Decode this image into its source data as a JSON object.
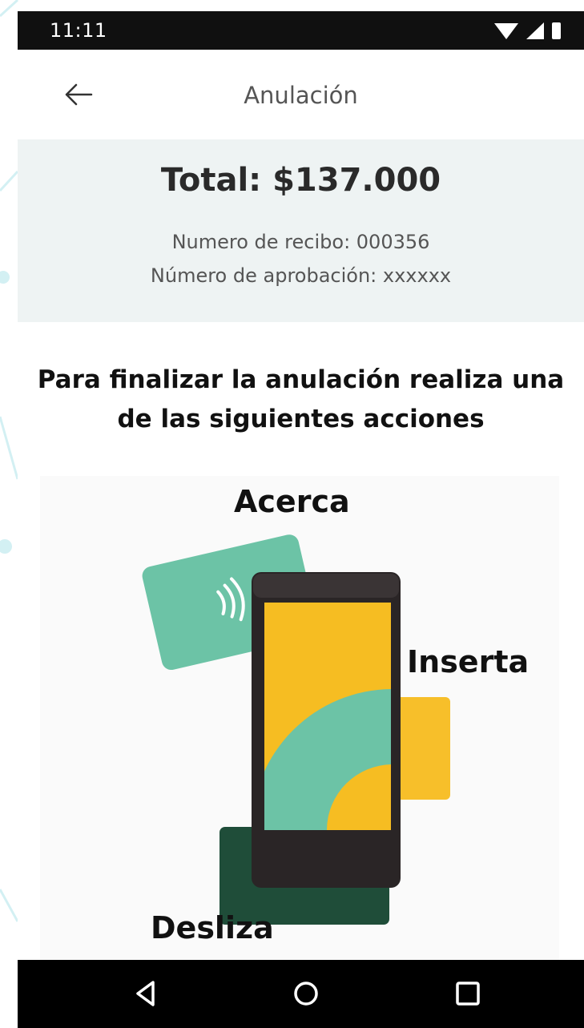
{
  "status_bar": {
    "time": "11:11"
  },
  "app_bar": {
    "title": "Anulación",
    "back_icon": "arrow-left-icon"
  },
  "summary": {
    "total": "Total: $137.000",
    "receipt_line": "Numero de recibo: 000356",
    "approval_line": "Número de aprobación: xxxxxx"
  },
  "instruction": "Para finalizar la anulación realiza una de las siguientes acciones",
  "illustration": {
    "tap_label": "Acerca",
    "insert_label": "Inserta",
    "swipe_label": "Desliza"
  },
  "nav_bar": {
    "back_icon": "triangle-back-icon",
    "home_icon": "circle-home-icon",
    "recents_icon": "square-recents-icon"
  },
  "colors": {
    "status_bar": "#101010",
    "summary_bg": "#eef3f3",
    "card_green": "#6cc3a6",
    "card_dark_green": "#1f4d39",
    "card_yellow": "#f7bf2a",
    "device_body": "#2a2526",
    "screen_yellow": "#f6bd22",
    "backdrop_line": "#d3f0f3"
  }
}
